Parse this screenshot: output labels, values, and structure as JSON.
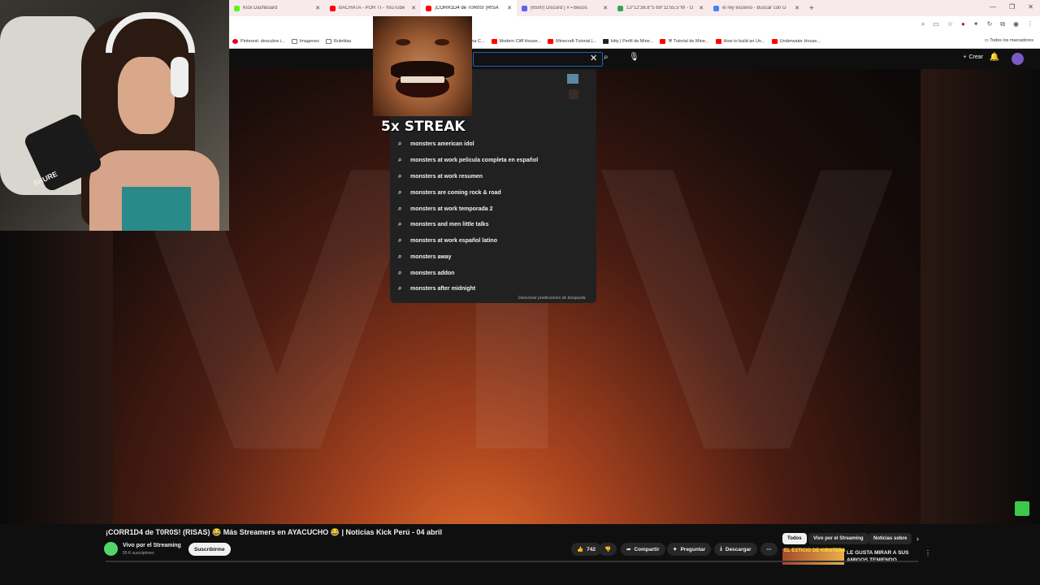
{
  "browser": {
    "tabs": [
      {
        "label": "Kick Dashboard",
        "favicon_color": "#53fc18",
        "active": false
      },
      {
        "label": "BACHATA - POR TI - YouTube",
        "favicon_color": "#ff0000",
        "active": false
      },
      {
        "label": "¡CORR1D4 de T0R0S! (RISA",
        "favicon_color": "#ff0000",
        "active": true
      },
      {
        "label": "(6500) Discord | # ▪ Besos",
        "favicon_color": "#5865f2",
        "active": false
      },
      {
        "label": "13°12'38.8\"S 69°11'55.5\"W - G",
        "favicon_color": "#34a853",
        "active": false
      },
      {
        "label": "el rey escenio - Buscar con G",
        "favicon_color": "#4285f4",
        "active": false
      }
    ],
    "new_tab": "+",
    "bookmarks": [
      {
        "label": "Pinterest: descubre i...",
        "color": "#e60023"
      },
      {
        "label": "Imagenes",
        "color": "#777777"
      },
      {
        "label": "Ruletitas",
        "color": "#777777"
      },
      {
        "label": "Como HACER una C...",
        "color": "#ff0000"
      },
      {
        "label": "Modern Cliff House...",
        "color": "#ff0000"
      },
      {
        "label": "Minecraft Tutorial |...",
        "color": "#ff0000"
      },
      {
        "label": "kitty | Perfil de Mine...",
        "color": "#222222"
      },
      {
        "label": "⚒ Tutorial de Mine...",
        "color": "#ff0000"
      },
      {
        "label": "How to build an Un...",
        "color": "#ff0000"
      },
      {
        "label": "Underwater House...",
        "color": "#ff0000"
      }
    ],
    "all_bookmarks": "Todos los marcadores"
  },
  "youtube": {
    "create_label": "Crear",
    "suggestions": [
      "monsters american idol",
      "monsters at work pelicula completa en español",
      "monsters at work resumen",
      "monsters are coming rock & road",
      "monsters at work temporada 2",
      "monsters and men little talks",
      "monsters at work español latino",
      "monsters away",
      "monsters addon",
      "monsters after midnight"
    ],
    "report_predictions": "Denunciar predicciones de búsqueda",
    "overlay_text": "5x STREAK",
    "video_bg_text": "VIV",
    "video_title": "¡CORR1D4 de T0R0S! (RISAS) 😂 Más Streamers en AYACUCHO 😂 | Noticias Kick Perú - 04 abril",
    "channel_name": "Vivo por el Streaming",
    "channel_subs": "55 K suscriptores",
    "subscribe": "Suscribirme",
    "like_count": "742",
    "share": "Compartir",
    "ask": "Preguntar",
    "download": "Descargar",
    "more": "⋯",
    "chips": [
      "Todos",
      "Vivo por el Streaming",
      "Noticias sobre"
    ],
    "rec_thumb_text": "EL ESTICIO DE KIRSTERA",
    "rec_title": "LE GUSTA MIRAR A SUS AMIGOS TENIENDO ..."
  },
  "webcam": {
    "mic_brand": "SHURE"
  }
}
